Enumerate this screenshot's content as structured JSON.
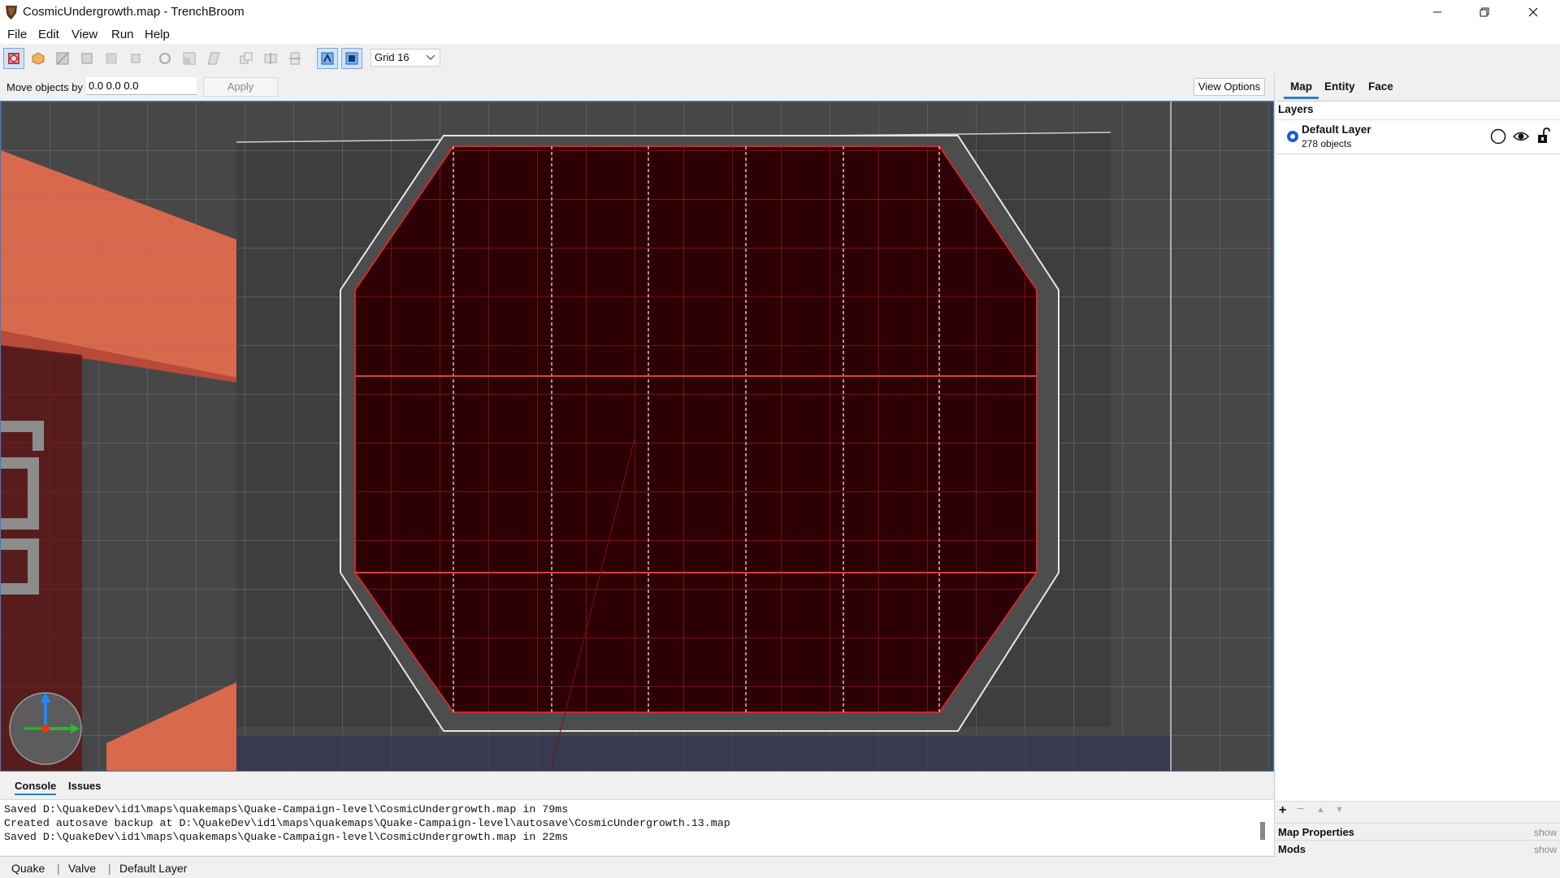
{
  "window": {
    "title": "CosmicUndergrowth.map - TrenchBroom"
  },
  "menu": [
    "File",
    "Edit",
    "View",
    "Run",
    "Help"
  ],
  "toolbar": {
    "grid_select": "Grid 16",
    "tools": [
      "select-tool-icon",
      "brush-tool-icon",
      "clip-tool-icon",
      "vertex-tool-icon",
      "edge-tool-icon",
      "face-tool-icon",
      "rotate-tool-icon",
      "scale-tool-icon",
      "shear-tool-icon",
      "duplicate-icon",
      "flip-horizontal-icon",
      "flip-vertical-icon",
      "texture-lock-icon",
      "uv-lock-icon"
    ]
  },
  "movebar": {
    "label": "Move objects by",
    "value": "0.0 0.0 0.0",
    "apply": "Apply",
    "view_options": "View Options"
  },
  "viewport": {
    "accent_selected": "#cc2a2a",
    "wall_color": "#4a4a4a"
  },
  "console": {
    "tabs": [
      "Console",
      "Issues"
    ],
    "lines": [
      "Saved D:\\QuakeDev\\id1\\maps\\quakemaps\\Quake-Campaign-level\\CosmicUndergrowth.map in 79ms",
      "Created autosave backup at D:\\QuakeDev\\id1\\maps\\quakemaps\\Quake-Campaign-level\\autosave\\CosmicUndergrowth.13.map",
      "Saved D:\\QuakeDev\\id1\\maps\\quakemaps\\Quake-Campaign-level\\CosmicUndergrowth.map in 22ms"
    ]
  },
  "status": {
    "game": "Quake",
    "format": "Valve",
    "layer": "Default Layer"
  },
  "right_panel": {
    "tabs": [
      "Map",
      "Entity",
      "Face"
    ],
    "layers_title": "Layers",
    "layer": {
      "name": "Default Layer",
      "count": "278 objects"
    },
    "map_properties": "Map Properties",
    "mods": "Mods",
    "show": "show"
  }
}
